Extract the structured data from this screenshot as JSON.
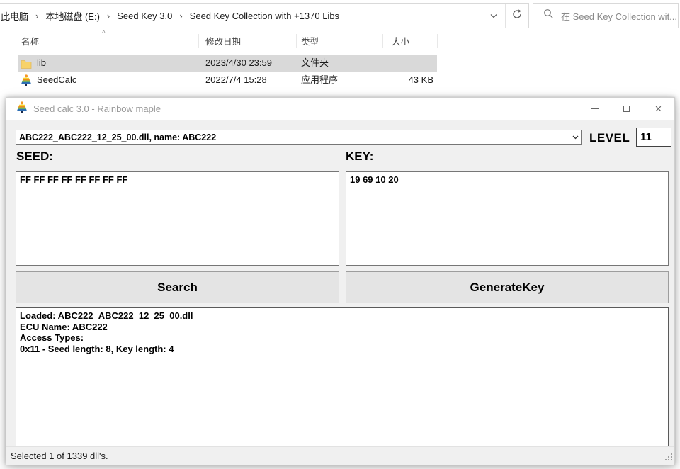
{
  "explorer": {
    "breadcrumb": {
      "separator": "›",
      "items": [
        "此电脑",
        "本地磁盘 (E:)",
        "Seed Key 3.0",
        "Seed Key Collection with +1370 Libs"
      ]
    },
    "search": {
      "placeholder": "在 Seed Key Collection wit..."
    },
    "list": {
      "columns": {
        "name": "名称",
        "date": "修改日期",
        "type": "类型",
        "size": "大小"
      },
      "sort_indicator": "^",
      "files": [
        {
          "name": "lib",
          "date": "2023/4/30 23:59",
          "type": "文件夹",
          "size": "",
          "selected": true
        },
        {
          "name": "SeedCalc",
          "date": "2022/7/4 15:28",
          "type": "应用程序",
          "size": "43 KB",
          "selected": false
        }
      ]
    }
  },
  "app": {
    "titlebar": {
      "title": "Seed calc 3.0 - Rainbow maple",
      "close_glyph": "×"
    },
    "dll_combobox": {
      "value": "ABC222_ABC222_12_25_00.dll, name: ABC222"
    },
    "level": {
      "label": "LEVEL",
      "value": "11"
    },
    "seed": {
      "label": "SEED:",
      "value": "FF FF FF FF FF FF FF FF"
    },
    "key": {
      "label": "KEY:",
      "value": "19 69 10 20"
    },
    "actions": {
      "search": "Search",
      "generate_key": "GenerateKey"
    },
    "log": {
      "text": "Loaded: ABC222_ABC222_12_25_00.dll\nECU Name: ABC222\nAccess Types:\n0x11 - Seed length: 8, Key length: 4"
    },
    "statusbar": {
      "text": "Selected 1 of 1339 dll's."
    }
  },
  "colors": {
    "selection_gray": "#d9d9d9",
    "window_bg": "#f0f0f0",
    "titlebar_bg": "#ffffff",
    "title_text": "#9a9a9a",
    "folder_yellow": "#f7d26a",
    "button_bg": "#e4e4e4",
    "control_border": "#767676"
  }
}
